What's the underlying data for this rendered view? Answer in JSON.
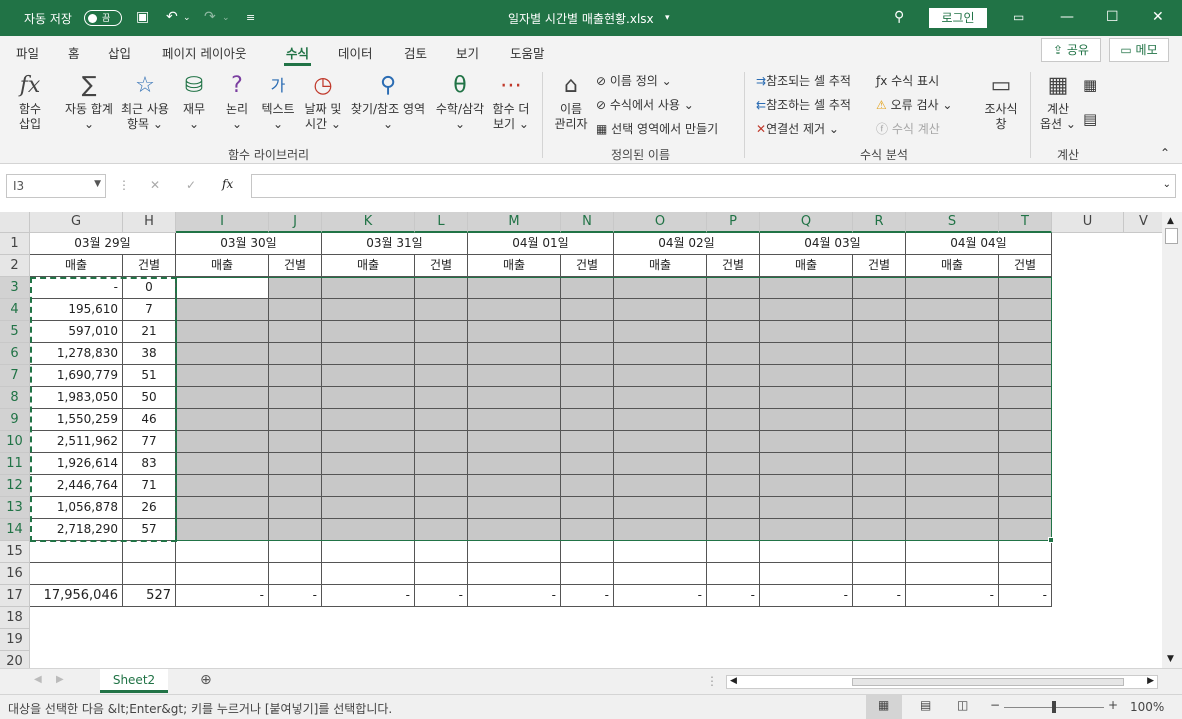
{
  "titlebar": {
    "autosave_label": "자동 저장",
    "autosave_state": "끔",
    "file_title": "일자별 시간별 매출현황.xlsx",
    "login_label": "로그인"
  },
  "ribbon_tabs": [
    "파일",
    "홈",
    "삽입",
    "페이지 레이아웃",
    "수식",
    "데이터",
    "검토",
    "보기",
    "도움말"
  ],
  "active_tab": "수식",
  "share_label": "공유",
  "memo_label": "메모",
  "ribbon": {
    "insert_function": "함수\n삽입",
    "insert_function_l1": "함수",
    "insert_function_l2": "삽입",
    "autosum_l1": "자동 합계",
    "recent_l1": "최근 사용",
    "recent_l2": "항목",
    "finance_l1": "재무",
    "logic_l1": "논리",
    "text_l1": "텍스트",
    "datetime_l1": "날짜 및",
    "datetime_l2": "시간",
    "lookup_l1": "찾기/참조",
    "lookup_l2": "영역",
    "math_l1": "수학/삼각",
    "more_l1": "함수 더",
    "more_l2": "보기",
    "group_library": "함수 라이브러리",
    "name_manager_l1": "이름",
    "name_manager_l2": "관리자",
    "define_name": "이름 정의",
    "use_in_formula": "수식에서 사용",
    "create_from_selection": "선택 영역에서 만들기",
    "group_names": "정의된 이름",
    "trace_precedents": "참조되는 셀 추적",
    "trace_dependents": "참조하는 셀 추적",
    "remove_arrows": "연결선 제거",
    "show_formulas": "수식 표시",
    "error_check": "오류 검사",
    "evaluate_formula": "수식 계산",
    "watch_l1": "조사식",
    "watch_l2": "창",
    "group_auditing": "수식 분석",
    "calc_options_l1": "계산",
    "calc_options_l2": "옵션",
    "group_calc": "계산"
  },
  "formula_bar": {
    "name_box": "I3",
    "fx": "fx",
    "content": ""
  },
  "columns": [
    "G",
    "H",
    "I",
    "J",
    "K",
    "L",
    "M",
    "N",
    "O",
    "P",
    "Q",
    "R",
    "S",
    "T",
    "U",
    "V"
  ],
  "rows": [
    "1",
    "2",
    "3",
    "4",
    "5",
    "6",
    "7",
    "8",
    "9",
    "10",
    "11",
    "12",
    "13",
    "14",
    "15",
    "16",
    "17",
    "18",
    "19",
    "20"
  ],
  "dates": [
    "03월 29일",
    "03월 30일",
    "03월 31일",
    "04월 01일",
    "04월 02일",
    "04월 03일",
    "04월 04일"
  ],
  "sub_headers": {
    "sales": "매출",
    "count": "건별"
  },
  "g_values": [
    "-",
    "195,610",
    "597,010",
    "1,278,830",
    "1,690,779",
    "1,983,050",
    "1,550,259",
    "2,511,962",
    "1,926,614",
    "2,446,764",
    "1,056,878",
    "2,718,290"
  ],
  "h_values": [
    "0",
    "7",
    "21",
    "38",
    "51",
    "50",
    "46",
    "77",
    "83",
    "71",
    "26",
    "57"
  ],
  "totals": {
    "g": "17,956,046",
    "h": "527",
    "dash": "-"
  },
  "sheet_tab": "Sheet2",
  "status_text": "대상을 선택한 다음 &lt;Enter&gt; 키를 누르거나 [붙여넣기]를 선택합니다.",
  "zoom": "100%"
}
